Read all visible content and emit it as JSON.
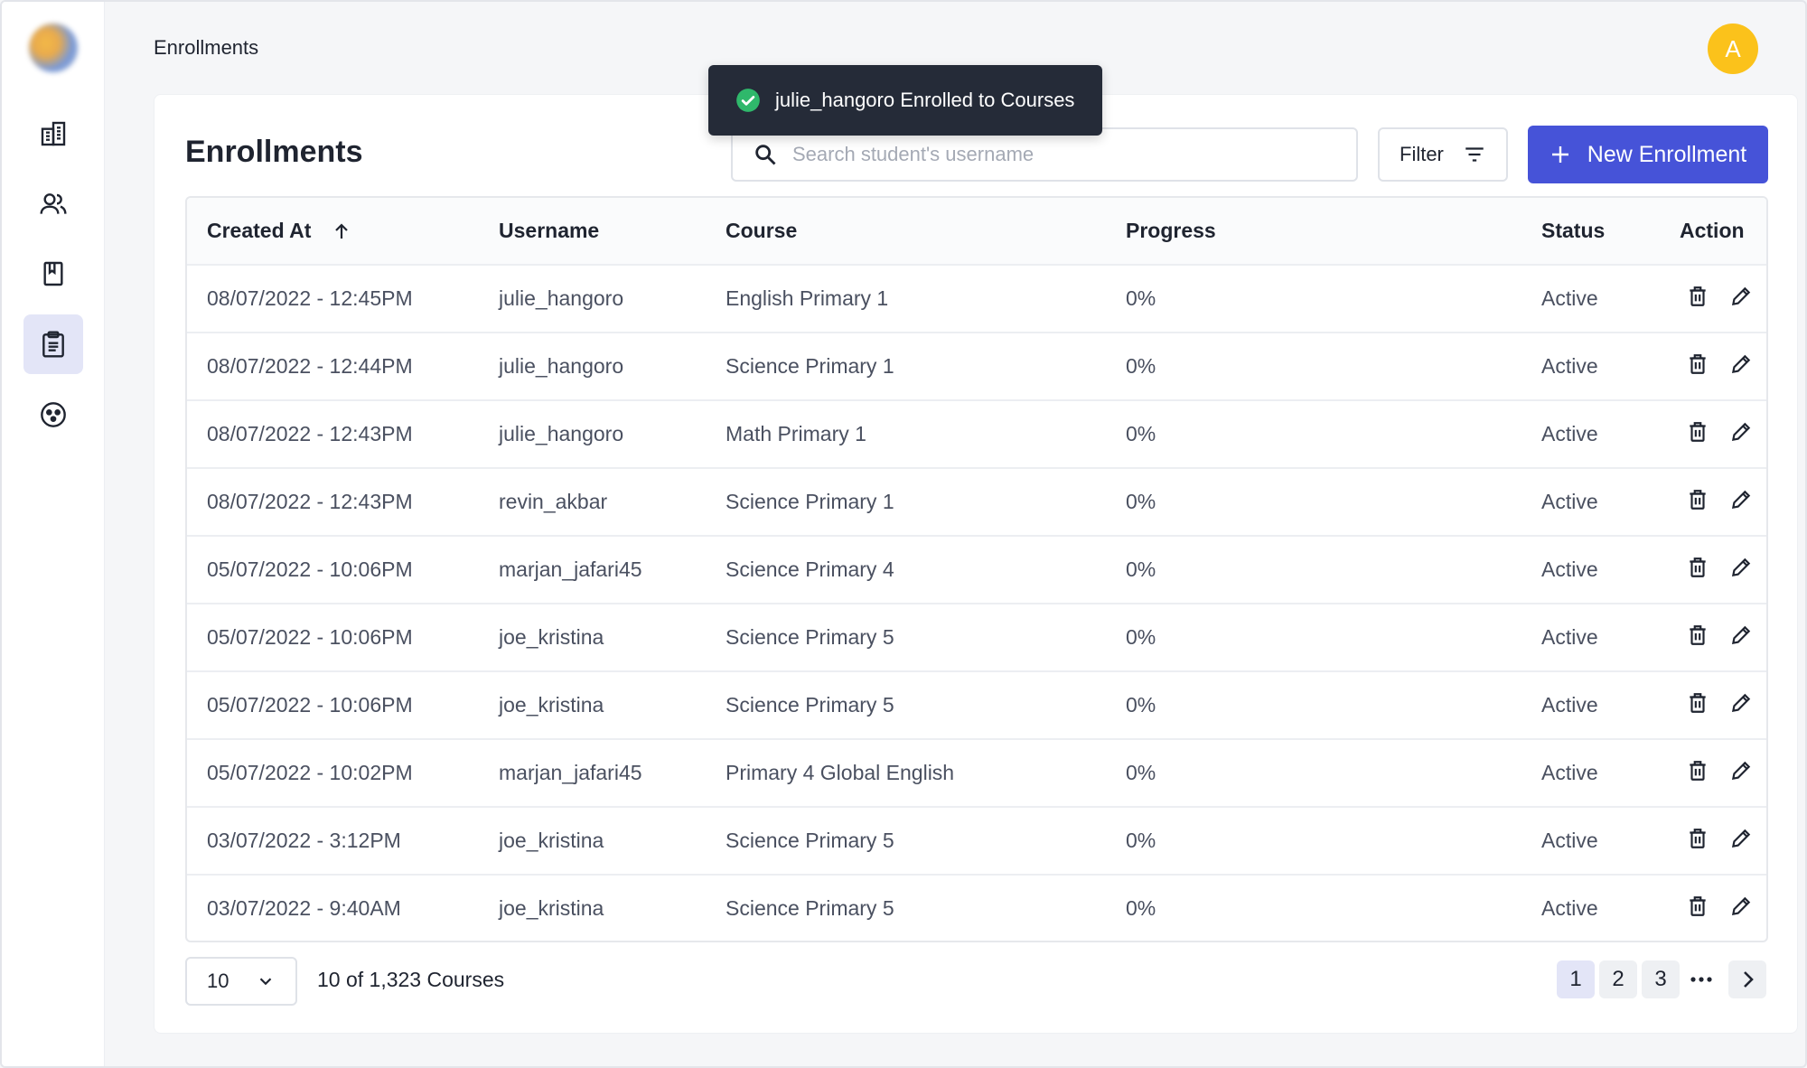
{
  "header": {
    "breadcrumb": "Enrollments",
    "avatar_initial": "A"
  },
  "toast": {
    "message": "julie_hangoro Enrolled to Courses",
    "icon": "check-circle-icon",
    "color": "#2fb86b"
  },
  "sidebar": {
    "items": [
      {
        "name": "buildings",
        "icon": "building-icon",
        "active": false
      },
      {
        "name": "users",
        "icon": "users-icon",
        "active": false
      },
      {
        "name": "courses",
        "icon": "book-icon",
        "active": false
      },
      {
        "name": "enrollments",
        "icon": "clipboard-icon",
        "active": true
      },
      {
        "name": "groups",
        "icon": "group-circle-icon",
        "active": false
      }
    ]
  },
  "main": {
    "title": "Enrollments",
    "search_placeholder": "Search student's username",
    "filter_label": "Filter",
    "new_button_label": "New Enrollment",
    "accent_color": "#4653d8"
  },
  "table": {
    "columns": [
      "Created At",
      "Username",
      "Course",
      "Progress",
      "Status",
      "Action"
    ],
    "rows": [
      {
        "created": "08/07/2022 - 12:45PM",
        "username": "julie_hangoro",
        "course": "English Primary 1",
        "progress": "0%",
        "status": "Active"
      },
      {
        "created": "08/07/2022 - 12:44PM",
        "username": "julie_hangoro",
        "course": "Science Primary 1",
        "progress": "0%",
        "status": "Active"
      },
      {
        "created": "08/07/2022 - 12:43PM",
        "username": "julie_hangoro",
        "course": "Math Primary 1",
        "progress": "0%",
        "status": "Active"
      },
      {
        "created": "08/07/2022 - 12:43PM",
        "username": "revin_akbar",
        "course": "Science Primary 1",
        "progress": "0%",
        "status": "Active"
      },
      {
        "created": "05/07/2022 - 10:06PM",
        "username": "marjan_jafari45",
        "course": "Science Primary 4",
        "progress": "0%",
        "status": "Active"
      },
      {
        "created": "05/07/2022 - 10:06PM",
        "username": "joe_kristina",
        "course": "Science Primary 5",
        "progress": "0%",
        "status": "Active"
      },
      {
        "created": "05/07/2022 - 10:06PM",
        "username": "joe_kristina",
        "course": "Science Primary 5",
        "progress": "0%",
        "status": "Active"
      },
      {
        "created": "05/07/2022 - 10:02PM",
        "username": "marjan_jafari45",
        "course": "Primary 4 Global English",
        "progress": "0%",
        "status": "Active"
      },
      {
        "created": "03/07/2022 - 3:12PM",
        "username": "joe_kristina",
        "course": "Science Primary 5",
        "progress": "0%",
        "status": "Active"
      },
      {
        "created": "03/07/2022 - 9:40AM",
        "username": "joe_kristina",
        "course": "Science Primary 5",
        "progress": "0%",
        "status": "Active"
      }
    ]
  },
  "footer": {
    "per_page": "10",
    "count_text": "10 of 1,323 Courses",
    "pages": [
      "1",
      "2",
      "3"
    ],
    "current_page": "1"
  }
}
